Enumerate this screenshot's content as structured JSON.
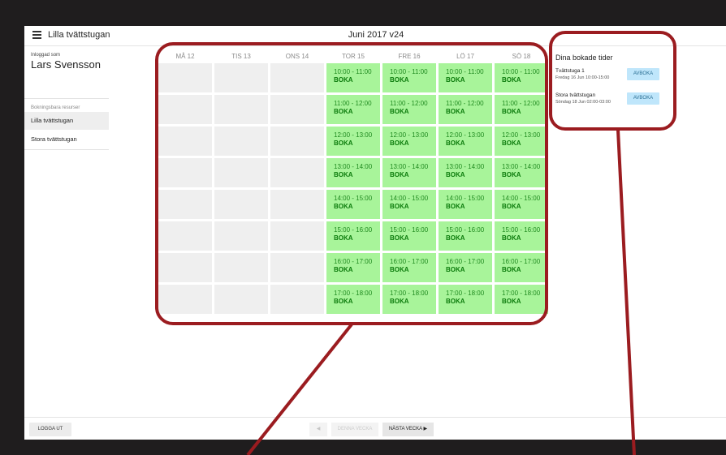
{
  "header": {
    "app_title": "Lilla tvättstugan",
    "week_title": "Juni 2017 v24",
    "menu_icon": "hamburger-menu-icon"
  },
  "sidebar": {
    "logged_in_label": "Inloggad som",
    "user_name": "Lars Svensson",
    "resources_label": "Bokningsbara resurser",
    "items": [
      {
        "label": "Lilla tvättstugan",
        "active": true
      },
      {
        "label": "Stora tvättstugan",
        "active": false
      }
    ]
  },
  "calendar": {
    "days": [
      "MÅ 12",
      "TIS 13",
      "ONS 14",
      "TOR 15",
      "FRE 16",
      "LÖ 17",
      "SÖ 18"
    ],
    "book_label": "BOKA",
    "available_from_day_index": 3,
    "time_slots": [
      "10:00 - 11:00",
      "11:00 - 12:00",
      "12:00 - 13:00",
      "13:00 - 14:00",
      "14:00 - 15:00",
      "15:00 - 16:00",
      "16:00 - 17:00",
      "17:00 - 18:00"
    ]
  },
  "booked": {
    "title": "Dina bokade tider",
    "items": [
      {
        "name": "Tvättstuga 1",
        "time": "Fredag 16 Jun 10:00-15:00",
        "button": "AVBOKA"
      },
      {
        "name": "Stora tvättstugan",
        "time": "Söndag 18 Jun 02:00-03:00",
        "button": "AVBOKA"
      }
    ]
  },
  "footer": {
    "logout": "LOGGA UT",
    "prev": "◀",
    "this_week": "DENNA VECKA",
    "next": "NÄSTA VECKA",
    "next_arrow": "▶"
  },
  "colors": {
    "slot_bg": "#a8f49a",
    "slot_text": "#208a20",
    "annotation": "#9b1c20",
    "avboka_bg": "#bfe6fb"
  }
}
